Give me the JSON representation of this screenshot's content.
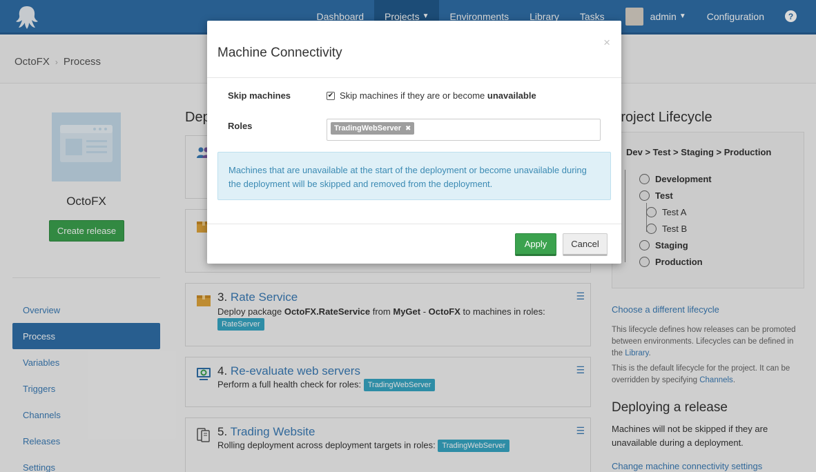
{
  "nav": {
    "items": [
      {
        "label": "Dashboard",
        "active": false
      },
      {
        "label": "Projects",
        "active": true
      },
      {
        "label": "Environments",
        "active": false
      },
      {
        "label": "Library",
        "active": false
      },
      {
        "label": "Tasks",
        "active": false
      }
    ],
    "user": "admin",
    "configuration": "Configuration",
    "help": "?"
  },
  "breadcrumb": {
    "project": "OctoFX",
    "page": "Process",
    "separator": "›"
  },
  "sidebar": {
    "project_name": "OctoFX",
    "create_release": "Create release",
    "items": [
      {
        "label": "Overview"
      },
      {
        "label": "Process"
      },
      {
        "label": "Variables"
      },
      {
        "label": "Triggers"
      },
      {
        "label": "Channels"
      },
      {
        "label": "Releases"
      },
      {
        "label": "Settings"
      }
    ]
  },
  "steps": {
    "title": "Dep",
    "items": [
      {
        "number": "3.",
        "name": "Rate Service",
        "desc_prefix": "Deploy package ",
        "package": "OctoFX.RateService",
        "desc_from": " from ",
        "feed": "MyGet",
        "desc_dash": " - ",
        "feed_name": "OctoFX",
        "desc_suffix": " to machines in roles:",
        "role": "RateServer"
      },
      {
        "number": "4.",
        "name": "Re-evaluate web servers",
        "desc": "Perform a full health check for roles:",
        "role": "TradingWebServer"
      },
      {
        "number": "5.",
        "name": "Trading Website",
        "desc": "Rolling deployment across deployment targets in roles:",
        "role": "TradingWebServer"
      }
    ]
  },
  "lifecycle": {
    "title": "Project Lifecycle",
    "path": "Dev > Test > Staging > Production",
    "nodes": [
      {
        "label": "Development"
      },
      {
        "label": "Test"
      },
      {
        "label": "Test A"
      },
      {
        "label": "Test B"
      },
      {
        "label": "Staging"
      },
      {
        "label": "Production"
      }
    ],
    "choose_link": "Choose a different lifecycle",
    "desc1_prefix": "This lifecycle defines how releases can be promoted between environments. Lifecycles can be defined in the ",
    "desc1_link": "Library",
    "desc1_suffix": ".",
    "desc2_prefix": "This is the default lifecycle for the project. It can be overridden by specifying ",
    "desc2_link": "Channels",
    "desc2_suffix": "."
  },
  "deploying": {
    "title": "Deploying a release",
    "text": "Machines will not be skipped if they are unavailable during a deployment.",
    "change_link": "Change machine connectivity settings"
  },
  "modal": {
    "title": "Machine Connectivity",
    "close": "×",
    "skip_label": "Skip machines",
    "skip_checked": true,
    "skip_text": "Skip machines if they are or become ",
    "skip_text_bold": "unavailable",
    "roles_label": "Roles",
    "roles": [
      "TradingWebServer"
    ],
    "info": "Machines that are unavailable at the start of the deployment or become unavailable during the deployment will be skipped and removed from the deployment.",
    "apply": "Apply",
    "cancel": "Cancel"
  },
  "colors": {
    "brand": "#2f6fa8",
    "success": "#3ba24e",
    "tag": "#37a6c4",
    "info_bg": "#dff0f7"
  }
}
